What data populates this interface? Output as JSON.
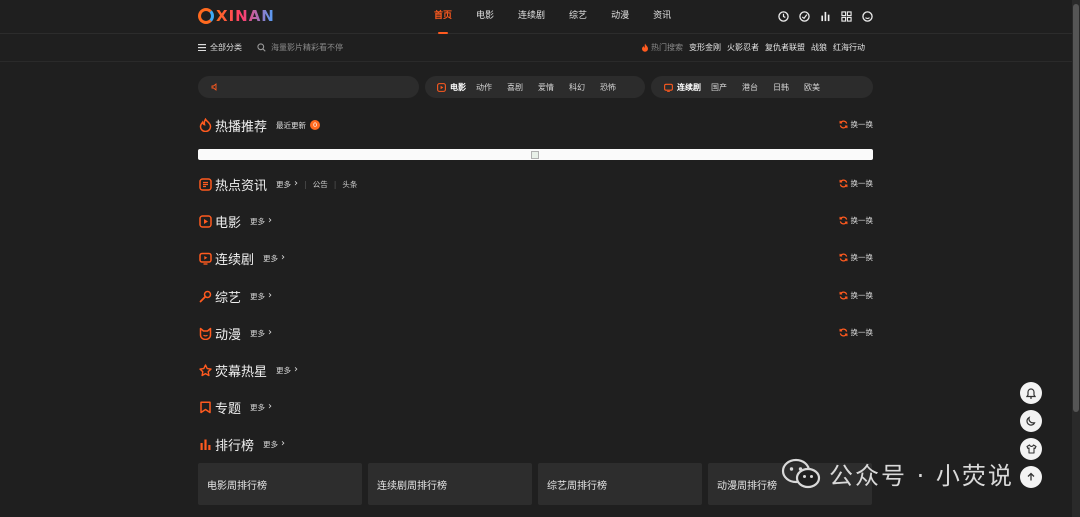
{
  "logo": {
    "text": "XINAN"
  },
  "nav": {
    "items": [
      "首页",
      "电影",
      "连续剧",
      "综艺",
      "动漫",
      "资讯"
    ],
    "active": "首页"
  },
  "top_icons": [
    "clock-icon",
    "chat-icon",
    "bar-chart-icon",
    "grid-icon",
    "face-icon"
  ],
  "subbar": {
    "all_categories": "全部分类",
    "search_placeholder": "海量影片精彩看不停",
    "hot_label": "热门搜索",
    "hot_keywords": [
      "变形金刚",
      "火影忍者",
      "复仇者联盟",
      "战狼",
      "红海行动"
    ]
  },
  "filters": {
    "movie": {
      "head": "电影",
      "tags": [
        "动作",
        "喜剧",
        "爱情",
        "科幻",
        "恐怖"
      ]
    },
    "series": {
      "head": "连续剧",
      "tags": [
        "国产",
        "港台",
        "日韩",
        "欧美"
      ]
    }
  },
  "sections": {
    "hot": {
      "title": "热播推荐",
      "sub": "最近更新",
      "badge": "0",
      "refresh": "换一换"
    },
    "news": {
      "title": "热点资讯",
      "more": "更多",
      "links": [
        "公告",
        "头条"
      ],
      "refresh": "换一换"
    },
    "movie": {
      "title": "电影",
      "more": "更多",
      "refresh": "换一换"
    },
    "series": {
      "title": "连续剧",
      "more": "更多",
      "refresh": "换一换"
    },
    "variety": {
      "title": "综艺",
      "more": "更多",
      "refresh": "换一换"
    },
    "anime": {
      "title": "动漫",
      "more": "更多",
      "refresh": "换一换"
    },
    "stars": {
      "title": "荧幕热星",
      "more": "更多"
    },
    "topics": {
      "title": "专题",
      "more": "更多"
    },
    "ranking": {
      "title": "排行榜",
      "more": "更多"
    }
  },
  "rank_cards": [
    "电影周排行榜",
    "连续剧周排行榜",
    "综艺周排行榜",
    "动漫周排行榜"
  ],
  "watermark": {
    "text": "公众号 · 小荧说"
  },
  "colors": {
    "accent": "#ff5a1f",
    "background": "#1f1f1f",
    "card": "#2d2d2d"
  }
}
